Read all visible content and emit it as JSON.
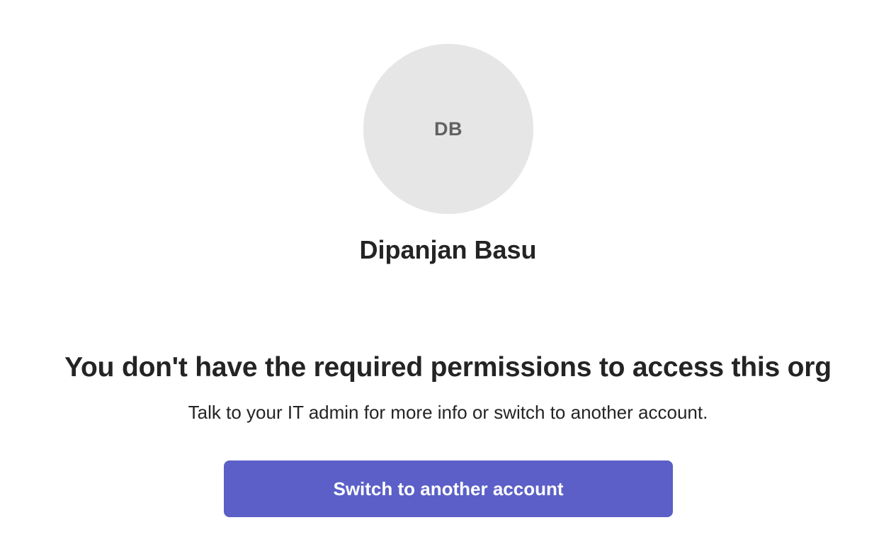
{
  "profile": {
    "initials": "DB",
    "name": "Dipanjan Basu"
  },
  "error": {
    "title": "You don't have the required permissions to access this org",
    "message": "Talk to your IT admin for more info or switch to another account."
  },
  "actions": {
    "switch_account_label": "Switch to another account"
  },
  "colors": {
    "accent": "#5b5fc7",
    "avatar_bg": "#e6e6e6",
    "avatar_text": "#616161",
    "text_primary": "#242424"
  }
}
